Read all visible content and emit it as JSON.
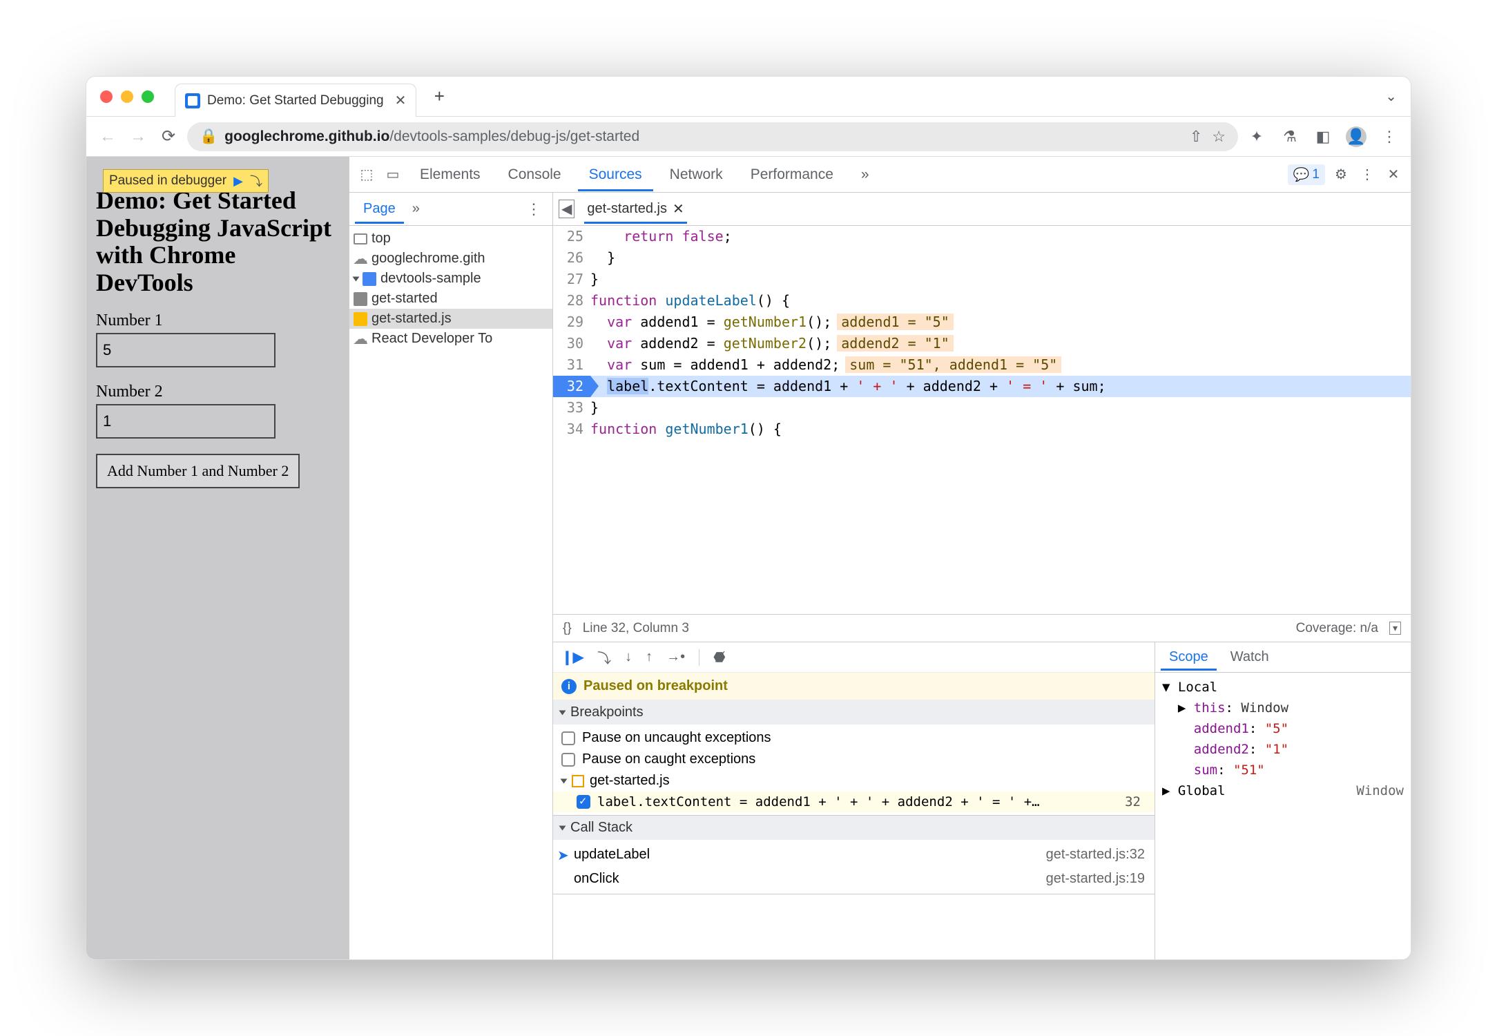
{
  "tab": {
    "title": "Demo: Get Started Debugging"
  },
  "url": {
    "host": "googlechrome.github.io",
    "path": "/devtools-samples/debug-js/get-started"
  },
  "page": {
    "heading": "Demo: Get Started Debugging JavaScript with Chrome DevTools",
    "label1": "Number 1",
    "value1": "5",
    "label2": "Number 2",
    "value2": "1",
    "button": "Add Number 1 and Number 2"
  },
  "overlay": {
    "text": "Paused in debugger"
  },
  "devtools": {
    "tabs": [
      "Elements",
      "Console",
      "Sources",
      "Network",
      "Performance"
    ],
    "activeTab": "Sources",
    "issuesCount": "1",
    "navigator": {
      "tab": "Page",
      "tree": {
        "top": "top",
        "domain": "googlechrome.gith",
        "folder": "devtools-sample",
        "html": "get-started",
        "js": "get-started.js",
        "ext": "React Developer To"
      }
    },
    "editor": {
      "file": "get-started.js",
      "lines": [
        {
          "n": "25",
          "indent": "    ",
          "tokens": [
            {
              "t": "return ",
              "c": "kw"
            },
            {
              "t": "false",
              "c": "kw"
            },
            {
              "t": ";",
              "c": ""
            }
          ]
        },
        {
          "n": "26",
          "indent": "  ",
          "tokens": [
            {
              "t": "}",
              "c": ""
            }
          ]
        },
        {
          "n": "27",
          "indent": "",
          "tokens": [
            {
              "t": "}",
              "c": ""
            }
          ]
        },
        {
          "n": "28",
          "indent": "",
          "tokens": [
            {
              "t": "function ",
              "c": "kw"
            },
            {
              "t": "updateLabel",
              "c": "def"
            },
            {
              "t": "() {",
              "c": ""
            }
          ]
        },
        {
          "n": "29",
          "indent": "  ",
          "tokens": [
            {
              "t": "var ",
              "c": "kw"
            },
            {
              "t": "addend1 = ",
              "c": ""
            },
            {
              "t": "getNumber1",
              "c": "func"
            },
            {
              "t": "();",
              "c": ""
            }
          ],
          "val": "addend1 = \"5\""
        },
        {
          "n": "30",
          "indent": "  ",
          "tokens": [
            {
              "t": "var ",
              "c": "kw"
            },
            {
              "t": "addend2 = ",
              "c": ""
            },
            {
              "t": "getNumber2",
              "c": "func"
            },
            {
              "t": "();",
              "c": ""
            }
          ],
          "val": "addend2 = \"1\""
        },
        {
          "n": "31",
          "indent": "  ",
          "tokens": [
            {
              "t": "var ",
              "c": "kw"
            },
            {
              "t": "sum = addend1 + addend2;",
              "c": ""
            }
          ],
          "val": "sum = \"51\", addend1 = \"5\""
        },
        {
          "n": "32",
          "indent": "  ",
          "hl": true,
          "tokens": [
            {
              "t": "label",
              "c": "",
              "sel": true
            },
            {
              "t": ".textContent = addend1 + ",
              "c": ""
            },
            {
              "t": "' + '",
              "c": "str"
            },
            {
              "t": " + addend2 + ",
              "c": ""
            },
            {
              "t": "' = '",
              "c": "str"
            },
            {
              "t": " + sum;",
              "c": ""
            }
          ]
        },
        {
          "n": "33",
          "indent": "",
          "tokens": [
            {
              "t": "}",
              "c": ""
            }
          ]
        },
        {
          "n": "34",
          "indent": "",
          "tokens": [
            {
              "t": "function ",
              "c": "kw"
            },
            {
              "t": "getNumber1",
              "c": "def"
            },
            {
              "t": "() {",
              "c": ""
            }
          ]
        }
      ],
      "cursor": "Line 32, Column 3",
      "coverage": "Coverage: n/a"
    },
    "debugger": {
      "pausedMsg": "Paused on breakpoint",
      "sections": {
        "breakpoints": {
          "title": "Breakpoints",
          "opt1": "Pause on uncaught exceptions",
          "opt2": "Pause on caught exceptions",
          "file": "get-started.js",
          "bpText": "label.textContent = addend1 + ' + ' + addend2 + ' = ' +…",
          "bpLine": "32"
        },
        "callstack": {
          "title": "Call Stack",
          "frames": [
            {
              "fn": "updateLabel",
              "loc": "get-started.js:32",
              "cur": true
            },
            {
              "fn": "onClick",
              "loc": "get-started.js:19"
            }
          ]
        }
      },
      "scope": {
        "tabs": [
          "Scope",
          "Watch"
        ],
        "local": "Local",
        "thisLabel": "this",
        "thisVal": "Window",
        "vars": [
          {
            "k": "addend1",
            "v": "\"5\""
          },
          {
            "k": "addend2",
            "v": "\"1\""
          },
          {
            "k": "sum",
            "v": "\"51\""
          }
        ],
        "global": "Global",
        "globalVal": "Window"
      }
    }
  }
}
